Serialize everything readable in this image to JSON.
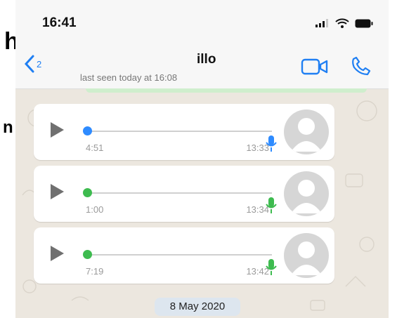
{
  "fragments": {
    "left_top": "h",
    "left_mid": "n"
  },
  "status_bar": {
    "time": "16:41"
  },
  "header": {
    "back_count": "2",
    "contact_name": "illo",
    "last_seen": "last seen today at 16:08"
  },
  "messages": [
    {
      "duration": "4:51",
      "time": "13:33",
      "state": "played",
      "accent": "#2e8bff"
    },
    {
      "duration": "1:00",
      "time": "13:34",
      "state": "unplayed",
      "accent": "#3dbb4f"
    },
    {
      "duration": "7:19",
      "time": "13:42",
      "state": "unplayed",
      "accent": "#3dbb4f"
    }
  ],
  "date_separator": "8 May 2020",
  "colors": {
    "ios_blue": "#1f7ff3",
    "whatsapp_green": "#3dbb4f",
    "played_blue": "#2e8bff"
  }
}
